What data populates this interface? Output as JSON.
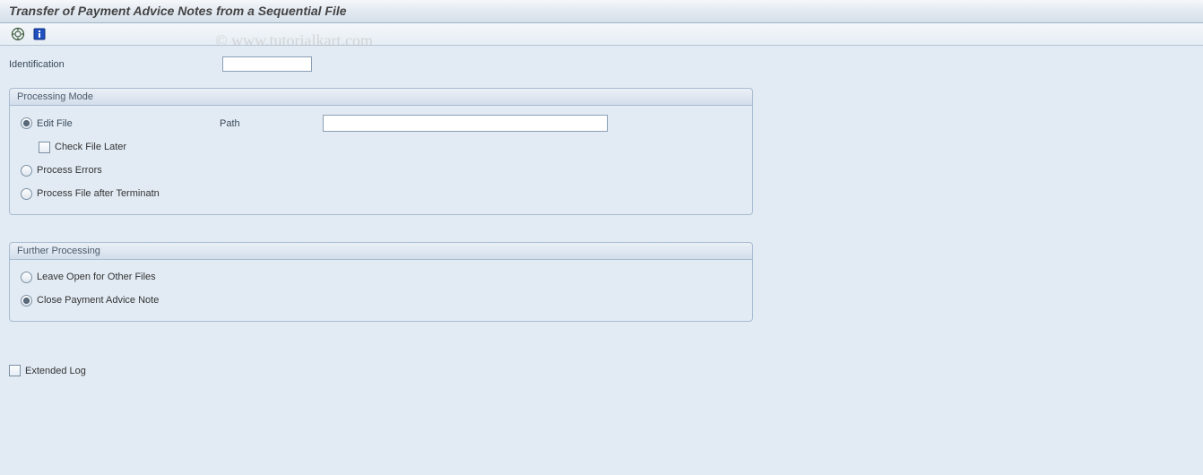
{
  "header": {
    "title": "Transfer of Payment Advice Notes from a Sequential File"
  },
  "toolbar": {
    "execute_icon": "execute",
    "info_icon": "info"
  },
  "identification": {
    "label": "Identification",
    "value": ""
  },
  "processing_mode": {
    "title": "Processing Mode",
    "edit_file": {
      "label": "Edit File",
      "selected": true
    },
    "check_later": {
      "label": "Check File Later",
      "checked": false
    },
    "process_errors": {
      "label": "Process Errors",
      "selected": false
    },
    "process_after_term": {
      "label": "Process File after Terminatn",
      "selected": false
    },
    "path": {
      "label": "Path",
      "value": ""
    }
  },
  "further_processing": {
    "title": "Further Processing",
    "leave_open": {
      "label": "Leave Open for Other Files",
      "selected": false
    },
    "close_note": {
      "label": "Close Payment Advice Note",
      "selected": true
    }
  },
  "extended_log": {
    "label": "Extended Log",
    "checked": false
  },
  "watermark": "© www.tutorialkart.com"
}
